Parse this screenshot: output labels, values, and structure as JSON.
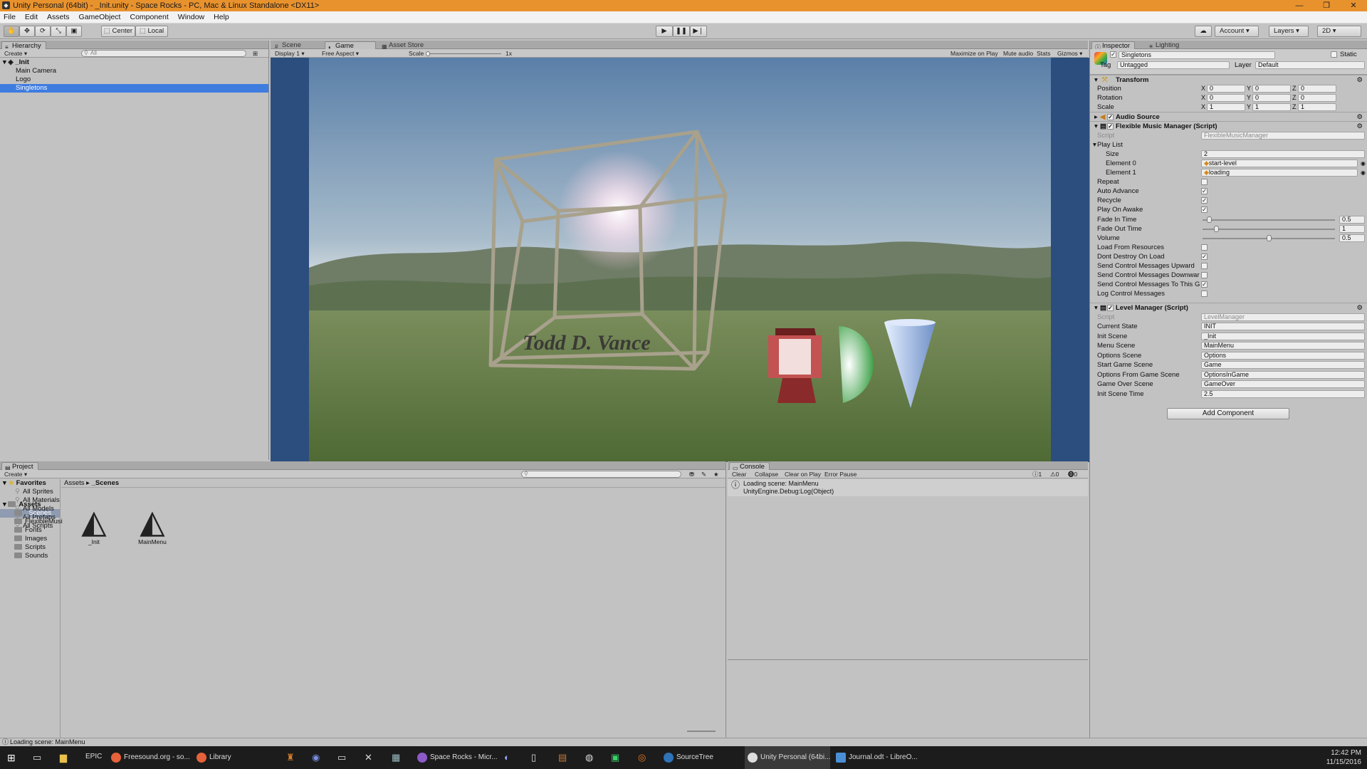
{
  "window": {
    "title": "Unity Personal (64bit) - _Init.unity - Space Rocks - PC, Mac & Linux Standalone <DX11>",
    "controls": [
      "—",
      "❐",
      "✕"
    ]
  },
  "menu": [
    "File",
    "Edit",
    "Assets",
    "GameObject",
    "Component",
    "Window",
    "Help"
  ],
  "toolbar": {
    "pivot": "Center",
    "space": "Local",
    "account": "Account",
    "layers": "Layers",
    "layout": "2D"
  },
  "hierarchy": {
    "tab": "Hierarchy",
    "create": "Create",
    "search_placeholder": "All",
    "scene": "_Init",
    "items": [
      "Main Camera",
      "Logo",
      "Singletons"
    ],
    "selected": "Singletons"
  },
  "gameview": {
    "tabs": [
      "Scene",
      "Game",
      "Asset Store"
    ],
    "active_tab": "Game",
    "display": "Display 1",
    "aspect": "Free Aspect",
    "scale_label": "Scale",
    "scale_value": "1x",
    "options": [
      "Maximize on Play",
      "Mute audio",
      "Stats",
      "Gizmos"
    ],
    "logo_text": "Todd D. Vance"
  },
  "inspector": {
    "tabs": [
      "Inspector",
      "Lighting"
    ],
    "object_name": "Singletons",
    "static_label": "Static",
    "tag_label": "Tag",
    "tag_value": "Untagged",
    "layer_label": "Layer",
    "layer_value": "Default",
    "transform": {
      "title": "Transform",
      "rows": [
        {
          "label": "Position",
          "x": "0",
          "y": "0",
          "z": "0"
        },
        {
          "label": "Rotation",
          "x": "0",
          "y": "0",
          "z": "0"
        },
        {
          "label": "Scale",
          "x": "1",
          "y": "1",
          "z": "1"
        }
      ]
    },
    "audio_source": "Audio Source",
    "music_manager": {
      "title": "Flexible Music Manager (Script)",
      "script_label": "Script",
      "script_value": "FlexibleMusicManager",
      "playlist_label": "Play List",
      "size_label": "Size",
      "size_value": "2",
      "elements": [
        {
          "label": "Element 0",
          "value": "start-level"
        },
        {
          "label": "Element 1",
          "value": "loading"
        }
      ],
      "bools": [
        {
          "label": "Repeat",
          "checked": false
        },
        {
          "label": "Auto Advance",
          "checked": true
        },
        {
          "label": "Recycle",
          "checked": true
        },
        {
          "label": "Play On Awake",
          "checked": true
        }
      ],
      "sliders": [
        {
          "label": "Fade In Time",
          "value": "0.5",
          "fraction": 0.05
        },
        {
          "label": "Fade Out Time",
          "value": "1",
          "fraction": 0.1
        },
        {
          "label": "Volume",
          "value": "0.5",
          "fraction": 0.5
        }
      ],
      "bools2": [
        {
          "label": "Load From Resources",
          "checked": false
        },
        {
          "label": "Dont Destroy On Load",
          "checked": true
        },
        {
          "label": "Send Control Messages Upward",
          "checked": false
        },
        {
          "label": "Send Control Messages Downwar",
          "checked": false
        },
        {
          "label": "Send Control Messages To This G",
          "checked": true
        },
        {
          "label": "Log Control Messages",
          "checked": false
        }
      ]
    },
    "level_manager": {
      "title": "Level Manager (Script)",
      "script_label": "Script",
      "script_value": "LevelManager",
      "fields": [
        {
          "label": "Current State",
          "value": "INIT"
        },
        {
          "label": "Init Scene",
          "value": "_Init"
        },
        {
          "label": "Menu Scene",
          "value": "MainMenu"
        },
        {
          "label": "Options Scene",
          "value": "Options"
        },
        {
          "label": "Start Game Scene",
          "value": "Game"
        },
        {
          "label": "Options From Game Scene",
          "value": "OptionsInGame"
        },
        {
          "label": "Game Over Scene",
          "value": "GameOver"
        },
        {
          "label": "Init Scene Time",
          "value": "2.5"
        }
      ]
    },
    "add_component": "Add Component"
  },
  "project": {
    "tab": "Project",
    "create": "Create",
    "favorites_label": "Favorites",
    "favorites": [
      "All Sprites",
      "All Materials",
      "All Models",
      "All Prefabs",
      "All Scripts"
    ],
    "assets_label": "Assets",
    "asset_folders": [
      "_Scenes",
      "FlexibleMusi",
      "Fonts",
      "Images",
      "Scripts",
      "Sounds"
    ],
    "selected_folder": "_Scenes",
    "breadcrumb": [
      "Assets",
      "_Scenes"
    ],
    "files": [
      "_Init",
      "MainMenu"
    ]
  },
  "console": {
    "tab": "Console",
    "buttons": [
      "Clear",
      "Collapse",
      "Clear on Play",
      "Error Pause"
    ],
    "counts": [
      "1",
      "0",
      "0"
    ],
    "entry_line1": "Loading scene: MainMenu",
    "entry_line2": "UnityEngine.Debug:Log(Object)"
  },
  "status_text": "Loading scene: MainMenu",
  "taskbar": {
    "items": [
      "Freesound.org - so...",
      "Library",
      "Space Rocks - Micr...",
      "SourceTree",
      "Unity Personal (64bi...",
      "Journal.odt - LibreO..."
    ],
    "time": "12:42 PM",
    "date": "11/15/2016"
  },
  "colors": {
    "title_orange": "#e8922e",
    "selection_blue": "#3e7ce0",
    "game_bg": "#2c4e7e"
  }
}
